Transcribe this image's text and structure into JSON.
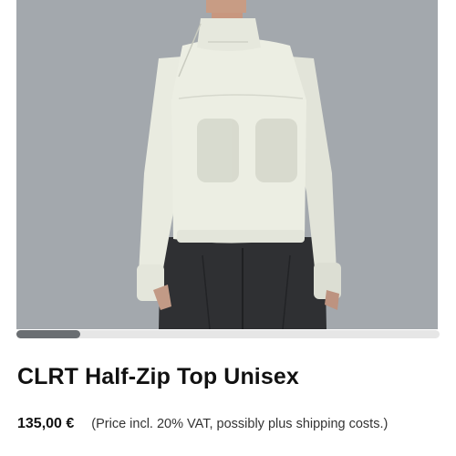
{
  "product": {
    "title": "CLRT Half-Zip Top Unisex",
    "price": "135,00 €",
    "price_note": "(Price incl. 20% VAT, possibly plus shipping costs.)"
  },
  "gallery": {
    "background_color": "#a3a8ad",
    "scroll_position": 0.15
  },
  "colors": {
    "scroll_thumb": "#6a6e72",
    "scroll_track": "#e6e6e6",
    "text": "#111111"
  }
}
